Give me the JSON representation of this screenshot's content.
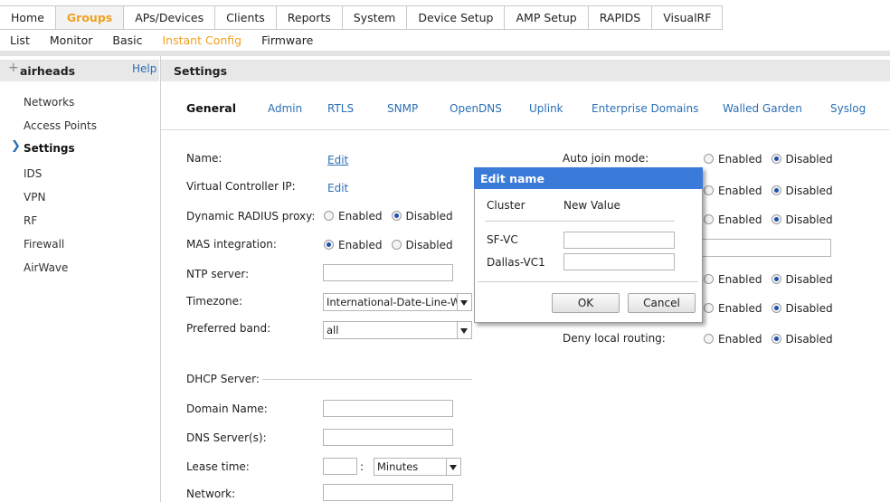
{
  "nav": {
    "tabs": [
      "Home",
      "Groups",
      "APs/Devices",
      "Clients",
      "Reports",
      "System",
      "Device Setup",
      "AMP Setup",
      "RAPIDS",
      "VisualRF"
    ],
    "active_tab": "Groups",
    "subtabs": [
      "List",
      "Monitor",
      "Basic",
      "Instant Config",
      "Firmware"
    ],
    "active_subtab": "Instant Config"
  },
  "sidebar": {
    "group_name": "airheads",
    "help": "Help",
    "items": [
      "Networks",
      "Access Points",
      "Settings",
      "IDS",
      "VPN",
      "RF",
      "Firewall",
      "AirWave"
    ],
    "active_item": "Settings"
  },
  "main": {
    "title": "Settings",
    "tabs": [
      "General",
      "Admin",
      "RTLS",
      "SNMP",
      "OpenDNS",
      "Uplink",
      "Enterprise Domains",
      "Walled Garden",
      "Syslog"
    ],
    "active_tab": "General",
    "fields": {
      "name_label": "Name:",
      "name_link": "Edit",
      "vc_ip_label": "Virtual Controller IP:",
      "vc_ip_link": "Edit",
      "dyn_radius_label": "Dynamic RADIUS proxy:",
      "mas_label": "MAS integration:",
      "ntp_label": "NTP server:",
      "timezone_label": "Timezone:",
      "timezone_value": "International-Date-Line-W",
      "band_label": "Preferred band:",
      "band_value": "all",
      "dhcp_label": "DHCP Server:",
      "domain_label": "Domain Name:",
      "dns_label": "DNS Server(s):",
      "lease_label": "Lease time:",
      "lease_sep": ":",
      "lease_unit": "Minutes",
      "network_label": "Network:",
      "auto_join_label": "Auto join mode:",
      "deny_routing_label": "Deny local routing:"
    },
    "radio": {
      "enabled": "Enabled",
      "disabled": "Disabled"
    }
  },
  "dialog": {
    "title": "Edit name",
    "col1": "Cluster",
    "col2": "New Value",
    "rows": [
      "SF-VC",
      "Dallas-VC1"
    ],
    "ok": "OK",
    "cancel": "Cancel"
  }
}
